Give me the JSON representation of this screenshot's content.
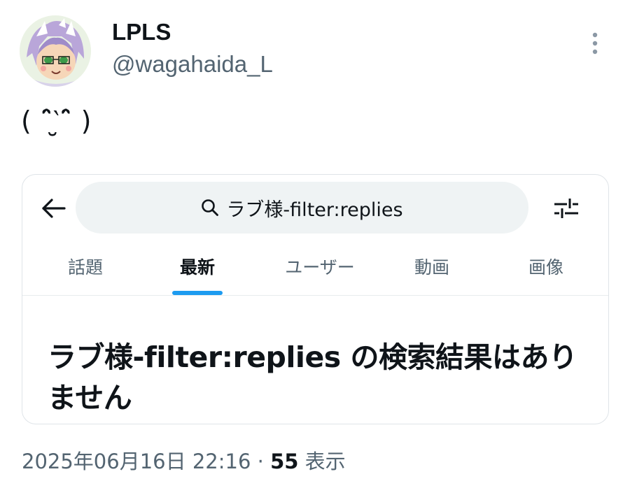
{
  "author": {
    "display_name": "LPLS",
    "handle": "@wagahaida_L"
  },
  "tweet": {
    "text": "( ˆ̑‵̮ˆ̑ )"
  },
  "embedded_screenshot": {
    "search": {
      "query": "ラブ様-filter:replies"
    },
    "tabs": [
      {
        "label": "話題"
      },
      {
        "label": "最新"
      },
      {
        "label": "ユーザー"
      },
      {
        "label": "動画"
      },
      {
        "label": "画像"
      }
    ],
    "active_tab": "最新",
    "empty_message": "ラブ様-filter:replies の検索結果はありません"
  },
  "meta": {
    "timestamp": "2025年06月16日 22:16",
    "separator": "·",
    "views_count": "55",
    "views_label": "表示"
  },
  "icons": {
    "more": "more-vertical-icon",
    "back": "back-arrow-icon",
    "search": "search-icon",
    "filter": "filter-sliders-icon"
  },
  "colors": {
    "text_primary": "#0f1419",
    "text_secondary": "#536471",
    "accent": "#1d9bf0",
    "search_bg": "#eff3f4"
  }
}
